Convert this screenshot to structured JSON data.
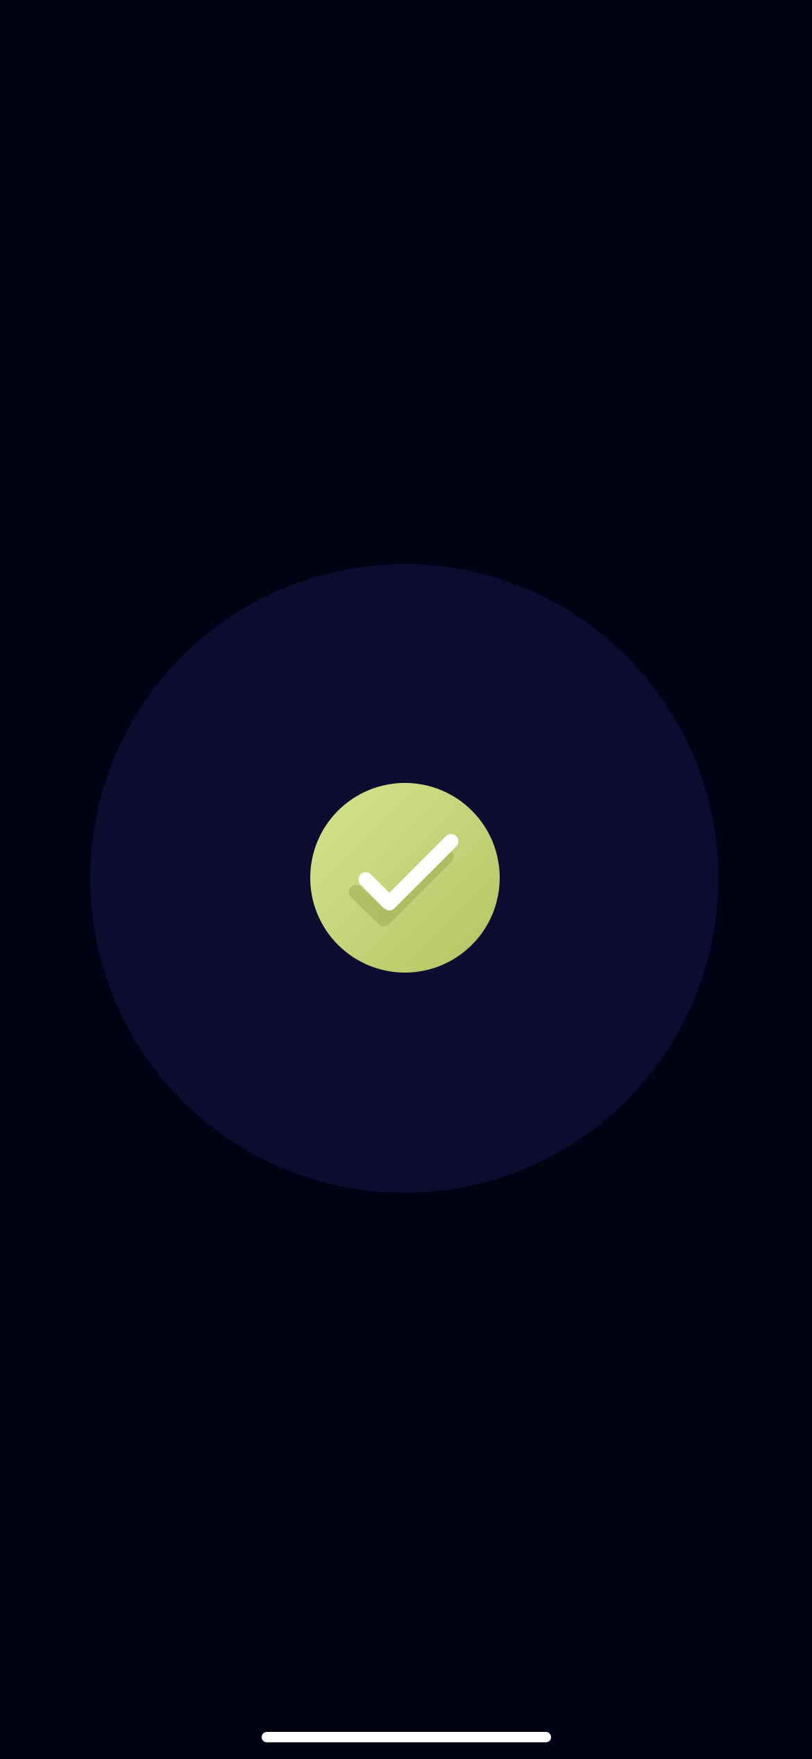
{
  "screen": {
    "state": "success",
    "colors": {
      "background": "#020215",
      "halo": "#0b0c2f",
      "badge_light": "#d7e390",
      "badge_dark": "#b4c364",
      "checkmark": "#ffffff",
      "home_indicator": "#ffffff"
    },
    "icon": "checkmark-icon"
  }
}
